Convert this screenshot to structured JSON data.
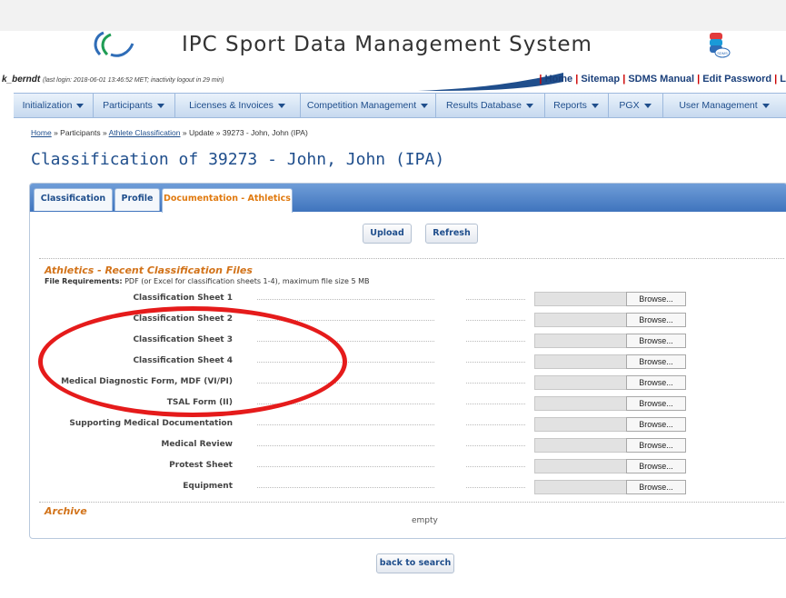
{
  "header": {
    "app_title": "IPC Sport Data Management System",
    "sdms_logo_text": "SDMS"
  },
  "userbar": {
    "username": "k_berndt",
    "login_info": "(last login: 2018-06-01 13:46:52 MET; inactivity logout in 29 min)",
    "links": [
      "Home",
      "Sitemap",
      "SDMS Manual",
      "Edit Password",
      "L"
    ]
  },
  "menu": [
    {
      "label": "Initialization"
    },
    {
      "label": "Participants"
    },
    {
      "label": "Licenses & Invoices"
    },
    {
      "label": "Competition Management"
    },
    {
      "label": "Results Database"
    },
    {
      "label": "Reports"
    },
    {
      "label": "PGX"
    },
    {
      "label": "User Management"
    }
  ],
  "breadcrumb": {
    "home": "Home",
    "sep": "»",
    "participants": "Participants",
    "athlete_classification": "Athlete Classification",
    "update": "Update",
    "current": "39273 - John, John (IPA)"
  },
  "page_title": "Classification of 39273 - John, John (IPA)",
  "tabs": [
    {
      "label": "Classification"
    },
    {
      "label": "Profile"
    },
    {
      "label": "Documentation - Athletics"
    }
  ],
  "actions": {
    "upload_label": "Upload",
    "refresh_label": "Refresh"
  },
  "recent": {
    "title": "Athletics - Recent Classification Files",
    "req_label": "File Requirements:",
    "req_text": "PDF (or Excel for classification sheets 1-4), maximum file size 5 MB",
    "browse_label": "Browse...",
    "files": [
      {
        "label": "Classification Sheet 1"
      },
      {
        "label": "Classification Sheet 2"
      },
      {
        "label": "Classification Sheet 3"
      },
      {
        "label": "Classification Sheet 4"
      },
      {
        "label": "Medical Diagnostic Form, MDF (VI/PI)"
      },
      {
        "label": "TSAL Form (II)"
      },
      {
        "label": "Supporting Medical Documentation"
      },
      {
        "label": "Medical Review"
      },
      {
        "label": "Protest Sheet"
      },
      {
        "label": "Equipment"
      }
    ]
  },
  "archive": {
    "title": "Archive",
    "empty_text": "empty"
  },
  "back_label": "back to search",
  "colors": {
    "accent_blue": "#1f4e8c",
    "tab_bar": "#4a7fc6",
    "section_orange": "#d2731a",
    "annotation_red": "#e51b1b"
  }
}
